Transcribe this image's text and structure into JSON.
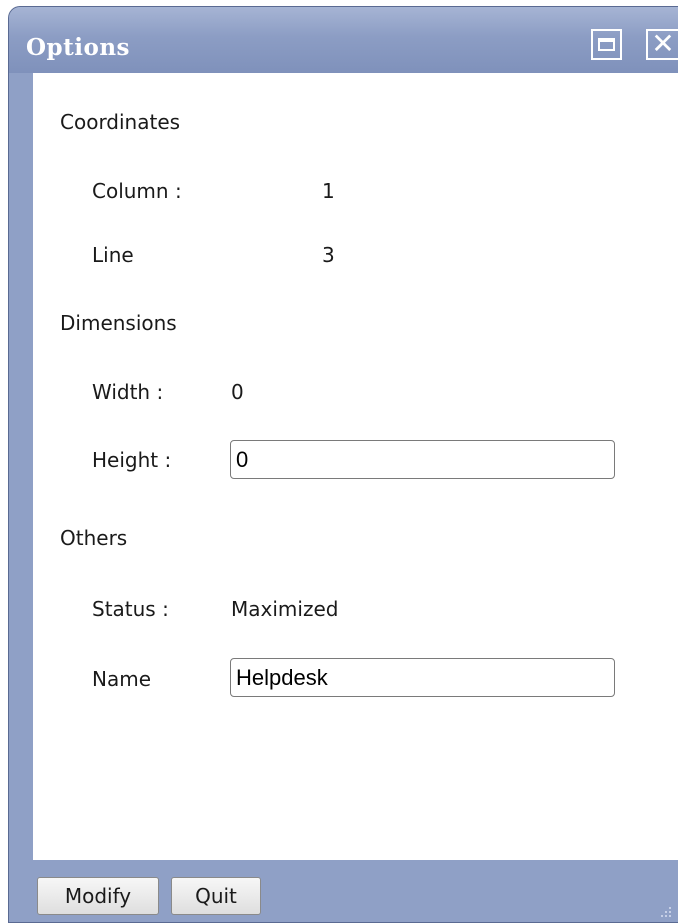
{
  "window": {
    "title": "Options"
  },
  "sections": {
    "coordinates": {
      "heading": "Coordinates",
      "column_label": "Column :",
      "column_value": "1",
      "line_label": "Line",
      "line_value": "3"
    },
    "dimensions": {
      "heading": "Dimensions",
      "width_label": "Width :",
      "width_value": "0",
      "height_label": "Height :",
      "height_value": "0"
    },
    "others": {
      "heading": "Others",
      "status_label": "Status :",
      "status_value": "Maximized",
      "name_label": "Name",
      "name_value": "Helpdesk"
    }
  },
  "buttons": {
    "modify": "Modify",
    "quit": "Quit"
  },
  "icons": {
    "maximize": "maximize-icon",
    "close": "close-icon",
    "resize": "resize-grip-icon"
  },
  "colors": {
    "titlebar": "#8c9dc4",
    "frame": "#8fa0c6"
  }
}
